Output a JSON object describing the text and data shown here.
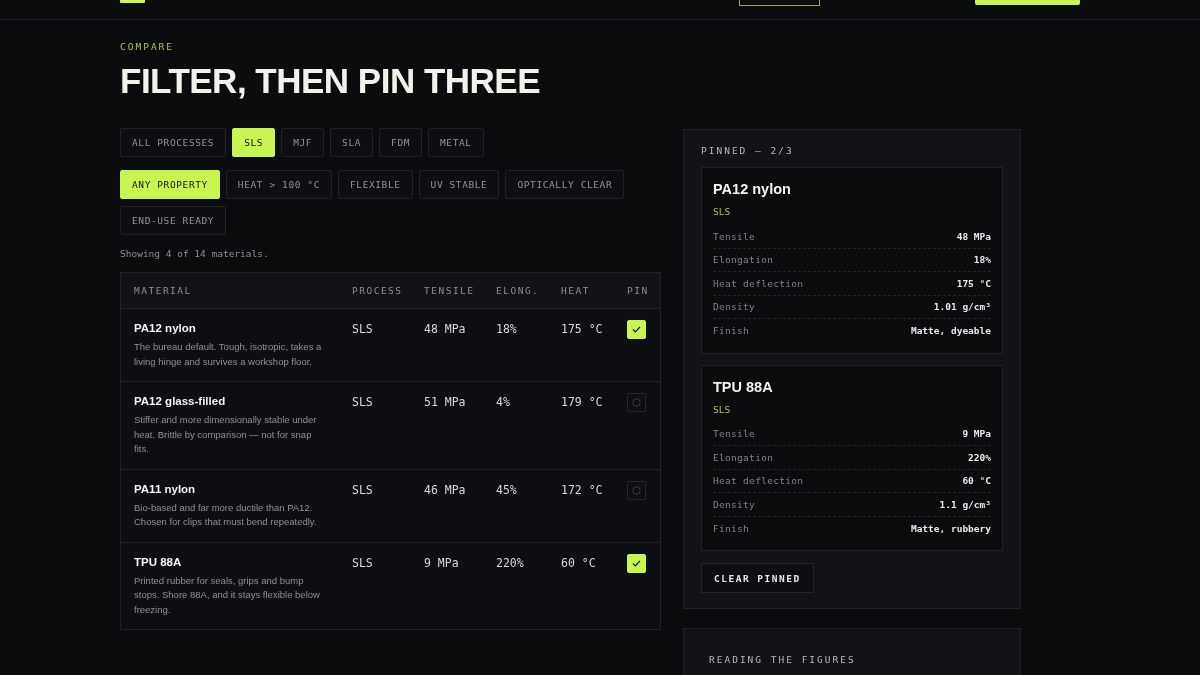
{
  "eyebrow": "COMPARE",
  "title": "FILTER, THEN PIN THREE",
  "process_filters": [
    {
      "label": "ALL PROCESSES",
      "selected": false
    },
    {
      "label": "SLS",
      "selected": true
    },
    {
      "label": "MJF",
      "selected": false
    },
    {
      "label": "SLA",
      "selected": false
    },
    {
      "label": "FDM",
      "selected": false
    },
    {
      "label": "METAL",
      "selected": false
    }
  ],
  "property_filters": [
    {
      "label": "ANY PROPERTY",
      "selected": true
    },
    {
      "label": "HEAT > 100 °C",
      "selected": false
    },
    {
      "label": "FLEXIBLE",
      "selected": false
    },
    {
      "label": "UV STABLE",
      "selected": false
    },
    {
      "label": "OPTICALLY CLEAR",
      "selected": false
    },
    {
      "label": "END-USE READY",
      "selected": false
    }
  ],
  "result_count": "Showing 4 of 14 materials.",
  "table": {
    "columns": [
      "MATERIAL",
      "PROCESS",
      "TENSILE",
      "ELONG.",
      "HEAT",
      "PIN"
    ],
    "rows": [
      {
        "name": "PA12 nylon",
        "description": "The bureau default. Tough, isotropic, takes a living hinge and survives a workshop floor.",
        "process": "SLS",
        "tensile": "48 MPa",
        "elongation": "18%",
        "heat": "175 °C",
        "pinned": true
      },
      {
        "name": "PA12 glass-filled",
        "description": "Stiffer and more dimensionally stable under heat. Brittle by comparison — not for snap fits.",
        "process": "SLS",
        "tensile": "51 MPa",
        "elongation": "4%",
        "heat": "179 °C",
        "pinned": false
      },
      {
        "name": "PA11 nylon",
        "description": "Bio-based and far more ductile than PA12. Chosen for clips that must bend repeatedly.",
        "process": "SLS",
        "tensile": "46 MPa",
        "elongation": "45%",
        "heat": "172 °C",
        "pinned": false
      },
      {
        "name": "TPU 88A",
        "description": "Printed rubber for seals, grips and bump stops. Shore 88A, and it stays flexible below freezing.",
        "process": "SLS",
        "tensile": "9 MPa",
        "elongation": "220%",
        "heat": "60 °C",
        "pinned": true
      }
    ]
  },
  "pinned": {
    "heading": "PINNED — 2/3",
    "cards": [
      {
        "name": "PA12 nylon",
        "process": "SLS",
        "specs": [
          {
            "label": "Tensile",
            "value": "48 MPa"
          },
          {
            "label": "Elongation",
            "value": "18%"
          },
          {
            "label": "Heat deflection",
            "value": "175 °C"
          },
          {
            "label": "Density",
            "value": "1.01 g/cm³"
          },
          {
            "label": "Finish",
            "value": "Matte, dyeable"
          }
        ]
      },
      {
        "name": "TPU 88A",
        "process": "SLS",
        "specs": [
          {
            "label": "Tensile",
            "value": "9 MPa"
          },
          {
            "label": "Elongation",
            "value": "220%"
          },
          {
            "label": "Heat deflection",
            "value": "60 °C"
          },
          {
            "label": "Density",
            "value": "1.1 g/cm³"
          },
          {
            "label": "Finish",
            "value": "Matte, rubbery"
          }
        ]
      }
    ],
    "clear_button": "CLEAR PINNED"
  },
  "guide": {
    "heading": "READING THE FIGURES"
  }
}
